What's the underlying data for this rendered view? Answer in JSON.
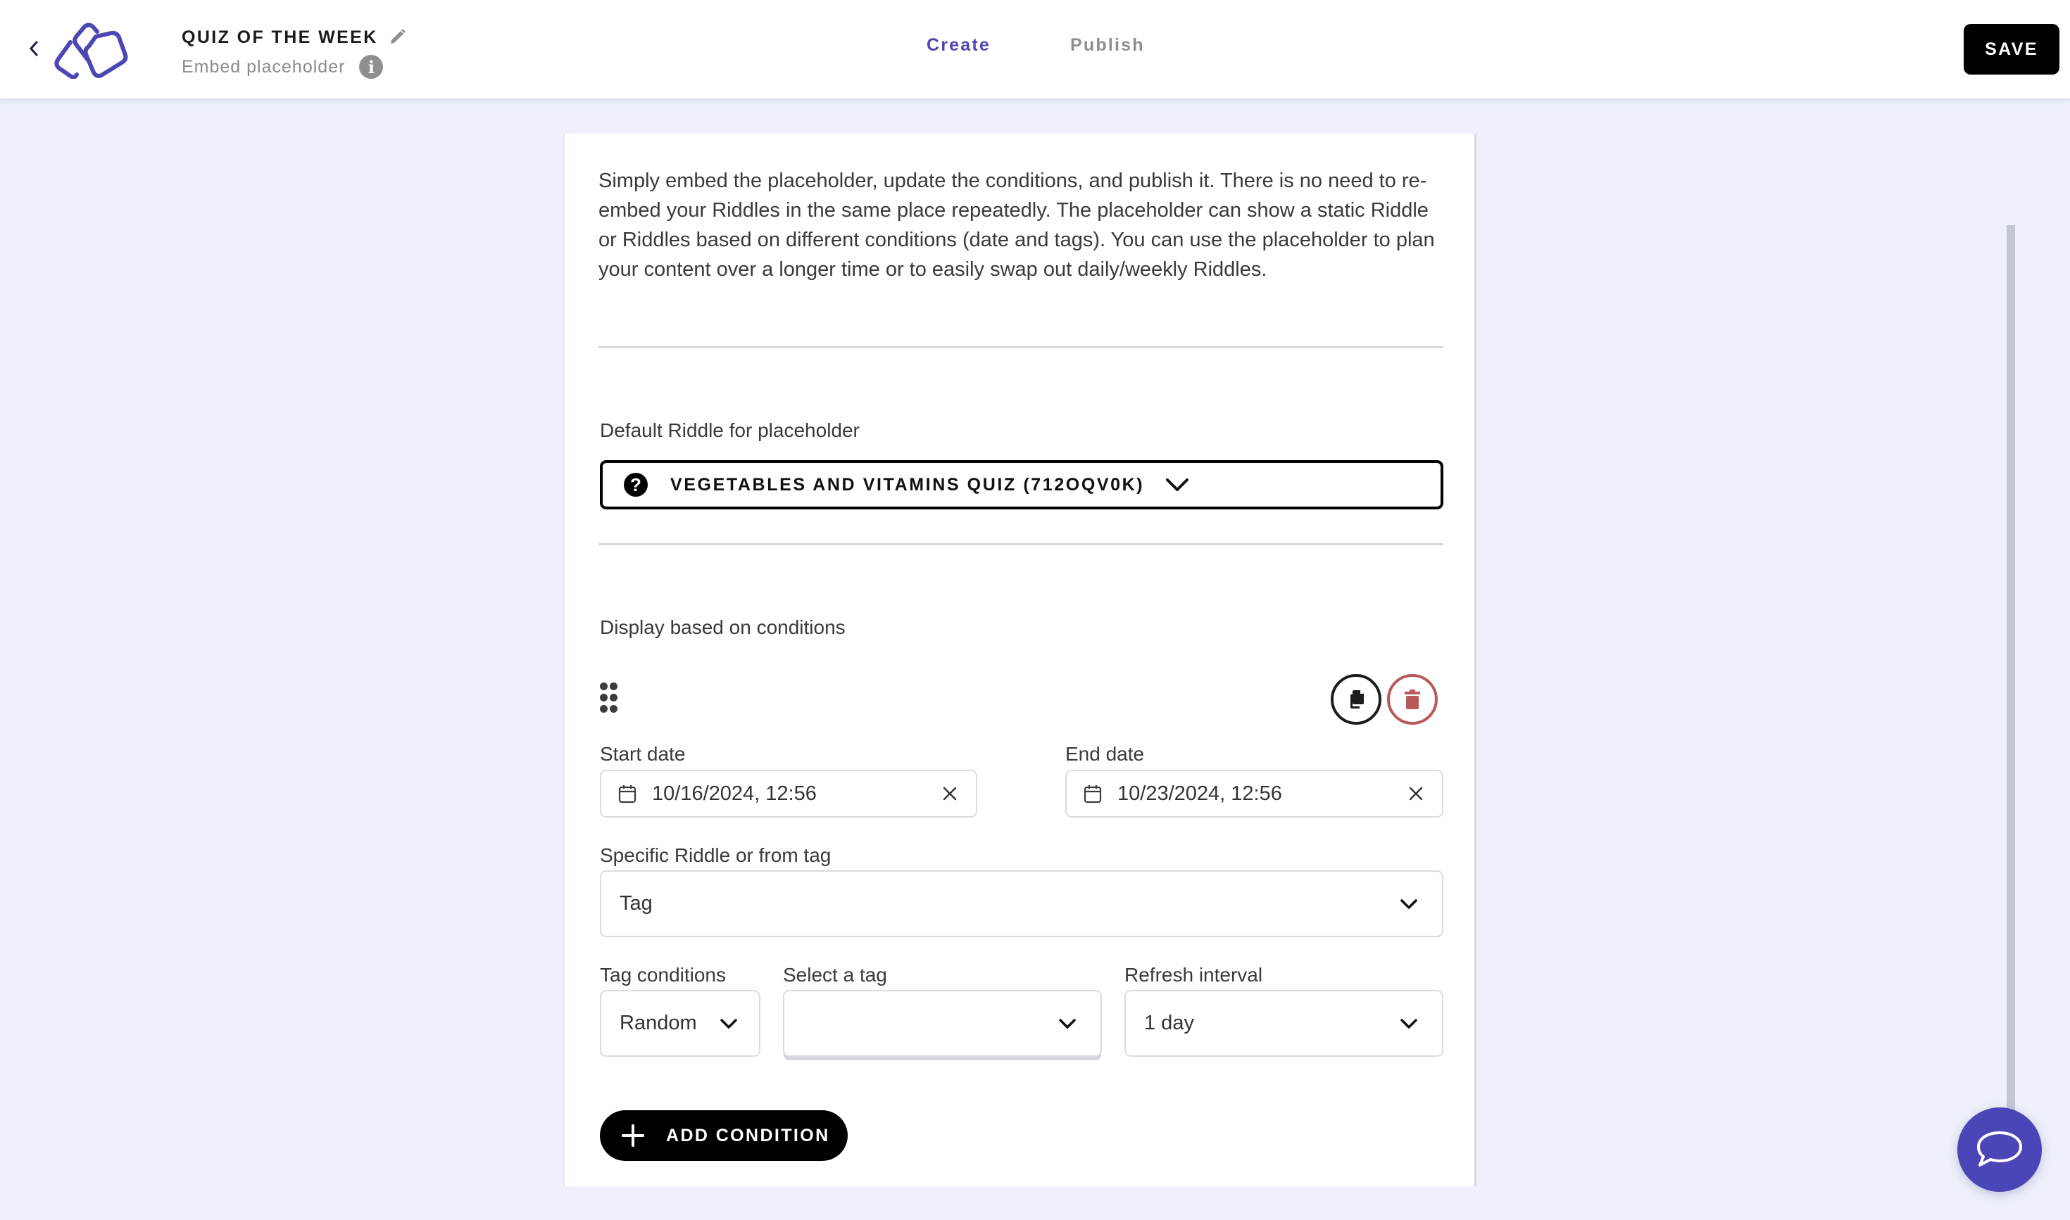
{
  "header": {
    "title": "QUIZ OF THE WEEK",
    "subtitle": "Embed placeholder",
    "tabs": [
      {
        "label": "Create",
        "active": true
      },
      {
        "label": "Publish",
        "active": false
      }
    ],
    "save_label": "SAVE",
    "info_glyph": "i"
  },
  "colors": {
    "brand": "#4d47b3",
    "delete": "#b85a5a",
    "background": "#eef1fb"
  },
  "intro_text": "Simply embed the placeholder, update the conditions, and publish it. There is no need to re-embed your Riddles in the same place repeatedly. The placeholder can show a static Riddle or Riddles based on different conditions (date and tags). You can use the placeholder to plan your content over a longer time or to easily swap out daily/weekly Riddles.",
  "default_riddle": {
    "label": "Default Riddle for placeholder",
    "icon_glyph": "?",
    "value": "VEGETABLES AND VITAMINS QUIZ (712OQV0K)"
  },
  "conditions": {
    "heading": "Display based on conditions",
    "items": [
      {
        "start_date_label": "Start date",
        "start_date": "10/16/2024, 12:56",
        "end_date_label": "End date",
        "end_date": "10/23/2024, 12:56",
        "source_label": "Specific Riddle or from tag",
        "source_value": "Tag",
        "tag_conditions_label": "Tag conditions",
        "tag_conditions_value": "Random",
        "select_tag_label": "Select a tag",
        "select_tag_value": "",
        "refresh_label": "Refresh interval",
        "refresh_value": "1 day"
      }
    ],
    "add_label": "ADD CONDITION"
  }
}
